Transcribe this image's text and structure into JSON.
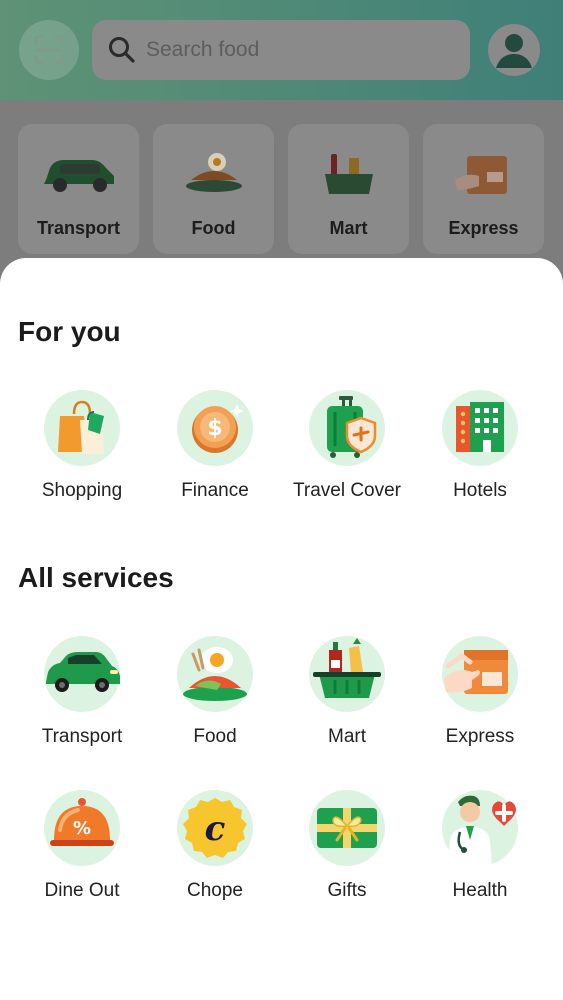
{
  "header": {
    "search_placeholder": "Search food"
  },
  "top_services": [
    {
      "label": "Transport"
    },
    {
      "label": "Food"
    },
    {
      "label": "Mart"
    },
    {
      "label": "Express"
    }
  ],
  "sheet": {
    "for_you_title": "For you",
    "for_you": [
      {
        "label": "Shopping",
        "icon": "shopping-bags-icon"
      },
      {
        "label": "Finance",
        "icon": "coin-icon"
      },
      {
        "label": "Travel Cover",
        "icon": "luggage-shield-icon"
      },
      {
        "label": "Hotels",
        "icon": "hotel-icon"
      }
    ],
    "all_services_title": "All services",
    "all_services": [
      {
        "label": "Transport",
        "icon": "car-icon"
      },
      {
        "label": "Food",
        "icon": "food-plate-icon"
      },
      {
        "label": "Mart",
        "icon": "grocery-basket-icon"
      },
      {
        "label": "Express",
        "icon": "parcel-icon"
      },
      {
        "label": "Dine Out",
        "icon": "cloche-icon"
      },
      {
        "label": "Chope",
        "icon": "chope-logo-icon"
      },
      {
        "label": "Gifts",
        "icon": "gift-card-icon"
      },
      {
        "label": "Health",
        "icon": "doctor-icon"
      }
    ]
  },
  "colors": {
    "accent_green": "#00b14f",
    "icon_bg": "#dcf3e2"
  }
}
